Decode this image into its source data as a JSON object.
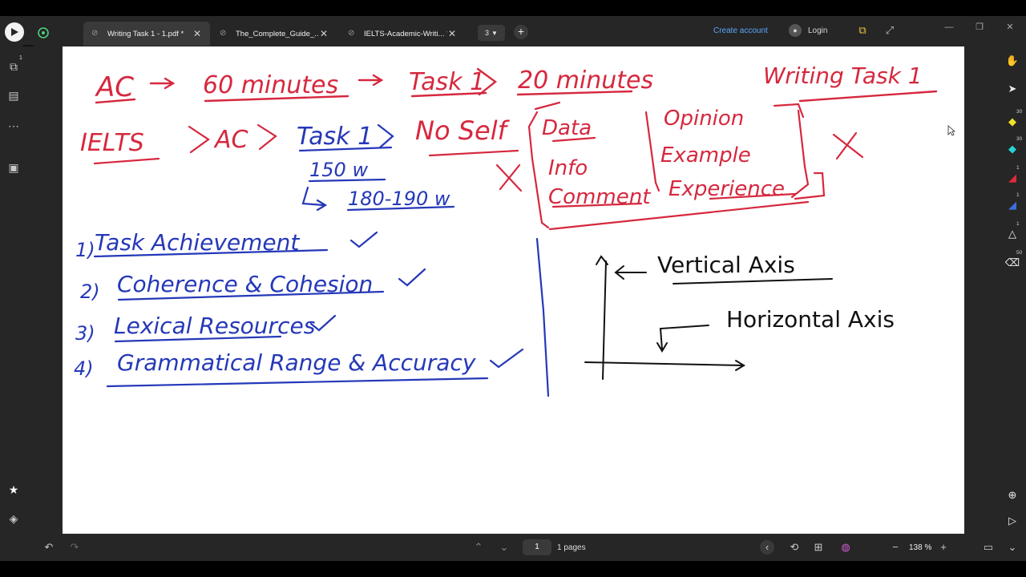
{
  "tabs": [
    {
      "title": "Writing Task 1 - 1.pdf *",
      "active": true
    },
    {
      "title": "The_Complete_Guide_...",
      "active": false
    },
    {
      "title": "IELTS-Academic-Writi... *",
      "active": false
    }
  ],
  "tab_count": "3",
  "header": {
    "create_account": "Create account",
    "login": "Login"
  },
  "left_sidebar": {
    "thumbnails_badge": "1"
  },
  "tool_sizes": {
    "highlighter_yellow": "30",
    "highlighter_cyan": "30",
    "pen_red": "1",
    "pen_blue": "1",
    "lasso": "1",
    "eraser": "50"
  },
  "footer": {
    "current_page": "1",
    "pages_label": "1 pages",
    "zoom": "138 %"
  },
  "notes": {
    "ac": "AC",
    "sixty_minutes": "60 minutes",
    "task1_a": "Task 1",
    "twenty_minutes": "20 minutes",
    "writing_task1": "Writing Task 1",
    "ielts": "IELTS",
    "ac2": "AC",
    "task1_b": "Task 1",
    "no_self": "No Self",
    "data": "Data",
    "info": "Info",
    "comment": "Comment",
    "opinion": "Opinion",
    "example": "Example",
    "experience": "Experience",
    "words150": "150 w",
    "words180": "180-190 w",
    "c1_num": "1)",
    "c1_text": "Task Achievement",
    "c2_num": "2)",
    "c2_text": "Coherence & Cohesion",
    "c3_num": "3)",
    "c3_text": "Lexical Resources",
    "c4_num": "4)",
    "c4_text": "Grammatical Range & Accuracy",
    "vertical_axis": "Vertical Axis",
    "horizontal_axis": "Horizontal Axis"
  },
  "colors": {
    "red_ink": "#d6283e",
    "blue_ink": "#2538b8",
    "black_ink": "#111111",
    "link": "#5aa6ff",
    "chrome": "#262626"
  }
}
